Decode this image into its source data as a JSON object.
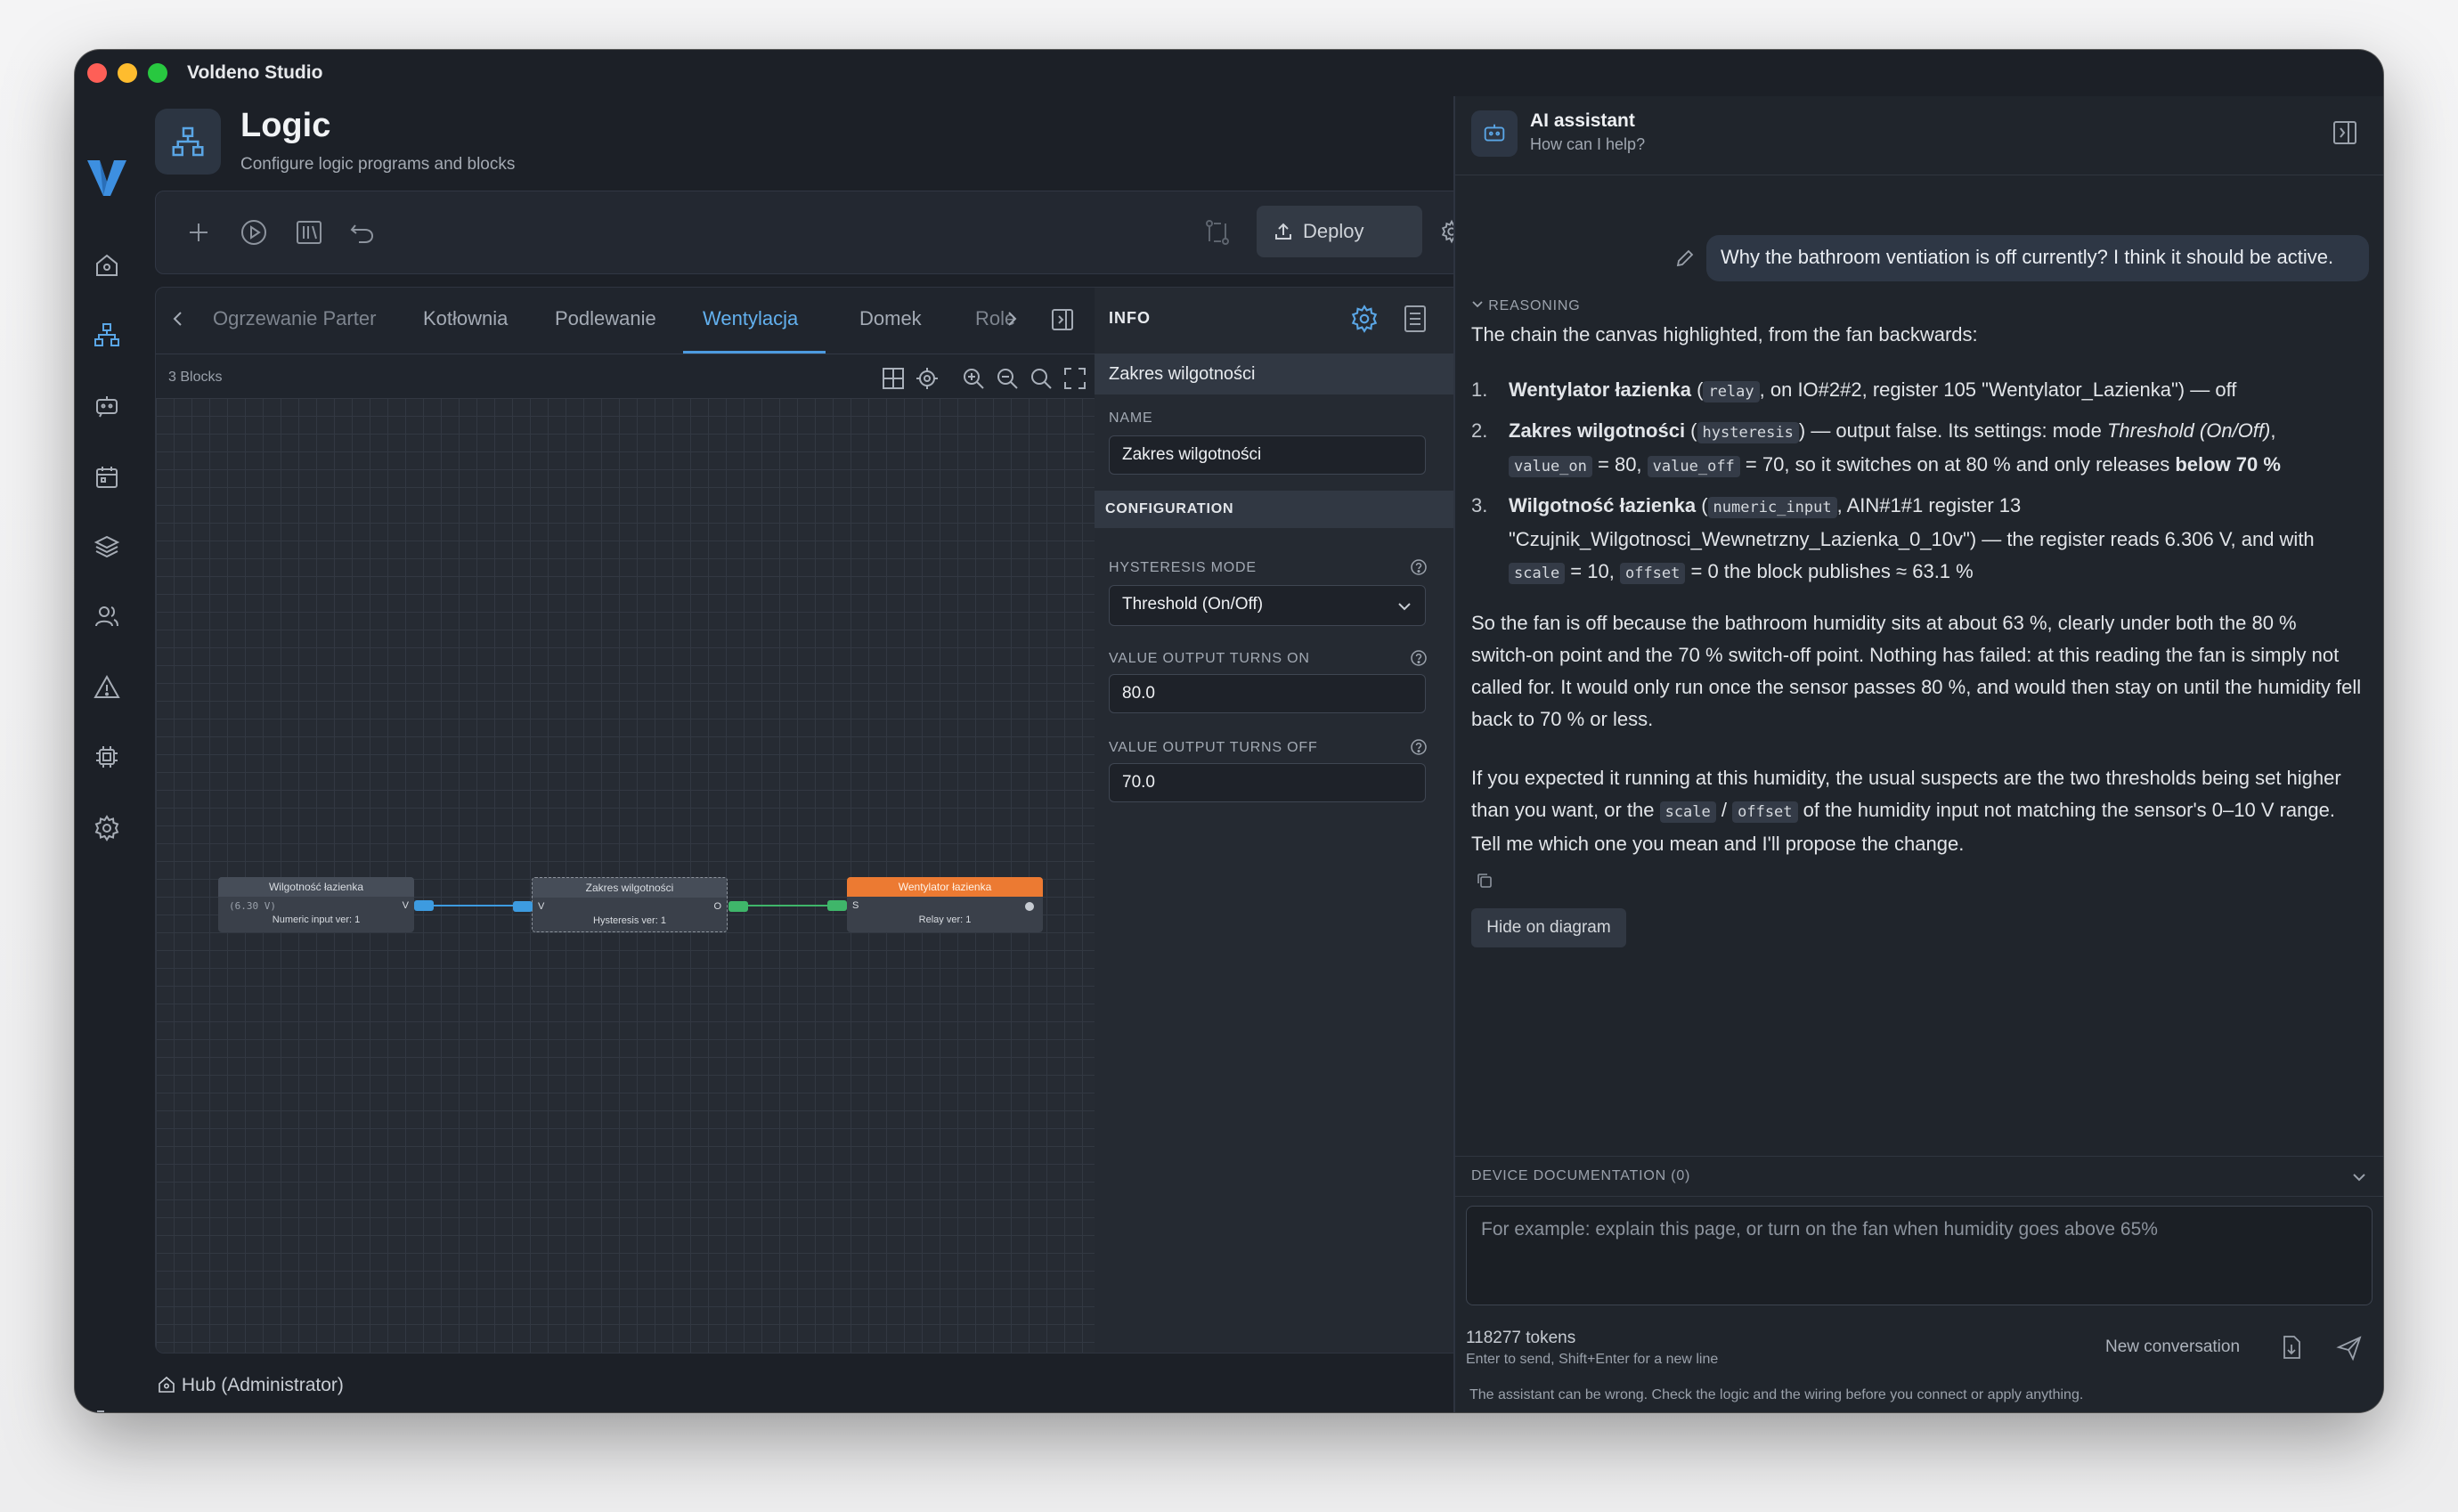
{
  "window": {
    "title": "Voldeno Studio"
  },
  "rail": {
    "icons": [
      "logo-icon",
      "home-icon",
      "logic-icon",
      "assistant-bot-icon",
      "calendar-icon",
      "layers-icon",
      "users-icon",
      "warning-icon",
      "chip-icon",
      "settings-icon",
      "logout-icon"
    ]
  },
  "header": {
    "title": "Logic",
    "subtitle": "Configure logic programs and blocks"
  },
  "toolbar": {
    "deploy_label": "Deploy"
  },
  "tabs": {
    "items": [
      "Ogrzewanie Parter",
      "Kotłownia",
      "Podlewanie",
      "Wentylacja",
      "Domek",
      "Role"
    ],
    "active": "Wentylacja"
  },
  "canvas": {
    "blocks_count": "3 Blocks",
    "nodes": [
      {
        "title": "Wilgotność łazienka",
        "value": "(6.30 V)",
        "port_out": "V",
        "footer": "Numeric input ver: 1"
      },
      {
        "title": "Zakres wilgotności",
        "port_in": "V",
        "port_out": "O",
        "footer": "Hysteresis ver: 1"
      },
      {
        "title": "Wentylator łazienka",
        "port_in": "S",
        "footer": "Relay ver: 1"
      }
    ]
  },
  "info": {
    "title": "INFO",
    "selected": "Zakres wilgotności",
    "name_label": "NAME",
    "name_value": "Zakres wilgotności",
    "config_label": "CONFIGURATION",
    "mode_label": "HYSTERESIS MODE",
    "mode_value": "Threshold (On/Off)",
    "on_label": "VALUE OUTPUT TURNS ON",
    "on_value": "80.0",
    "off_label": "VALUE OUTPUT TURNS OFF",
    "off_value": "70.0"
  },
  "status": {
    "hub": "Hub (Administrator)"
  },
  "assistant": {
    "title": "AI assistant",
    "subtitle": "How can I help?",
    "user_message": "Why the bathroom ventiation is off currently? I think it should be active.",
    "reasoning_label": "REASONING",
    "intro": "The chain the canvas highlighted, from the fan backwards:",
    "item1": {
      "bold": "Wentylator łazienka",
      "a": " (",
      "code": "relay",
      "b": ", on IO#2#2, register 105 \"Wentylator_Lazienka\") — off"
    },
    "item2": {
      "bold": "Zakres wilgotności",
      "a": " (",
      "code1": "hysteresis",
      "b": ") — output false. Its settings: mode ",
      "italic": "Threshold (On/Off)",
      "c": ",",
      "code2": "value_on",
      "d": " = 80, ",
      "code3": "value_off",
      "e": " = 70, so it switches on at 80 % and only releases ",
      "bold2": "below 70 %"
    },
    "item3": {
      "bold": "Wilgotność łazienka",
      "a": " (",
      "code1": "numeric_input",
      "b": ", AIN#1#1 register 13",
      "line2": "\"Czujnik_Wilgotnosci_Wewnetrzny_Lazienka_0_10v\") — the register reads 6.306 V, and with",
      "code2": "scale",
      "c": " = 10, ",
      "code3": "offset",
      "d": " = 0 the block publishes ≈ 63.1 %"
    },
    "para1": "So the fan is off because the bathroom humidity sits at about 63 %, clearly under both the 80 % switch-on point and the 70 % switch-off point. Nothing has failed: at this reading the fan is simply not called for. It would only run once the sensor passes 80 %, and would then stay on until the humidity fell back to 70 % or less.",
    "para2": {
      "a": "If you expected it running at this humidity, the usual suspects are the two thresholds being set higher than you want, or the ",
      "code1": "scale",
      "sep": " / ",
      "code2": "offset",
      "b": " of the humidity input not matching the sensor's 0–10 V range. Tell me which one you mean and I'll propose the change."
    },
    "hide_button": "Hide on diagram",
    "doc_label": "DEVICE DOCUMENTATION (0)",
    "prompt_placeholder": "For example: explain this page, or turn on the fan when humidity goes above 65%",
    "tokens": "118277 tokens",
    "hint": "Enter to send, Shift+Enter for a new line",
    "new_conversation": "New conversation",
    "disclaimer": "The assistant can be wrong. Check the logic and the wiring before you connect or apply anything."
  },
  "colors": {
    "accent": "#4c9be0",
    "relay_header": "#ec7a32",
    "port_blue": "#3d9be0",
    "port_green": "#3fb66a"
  }
}
